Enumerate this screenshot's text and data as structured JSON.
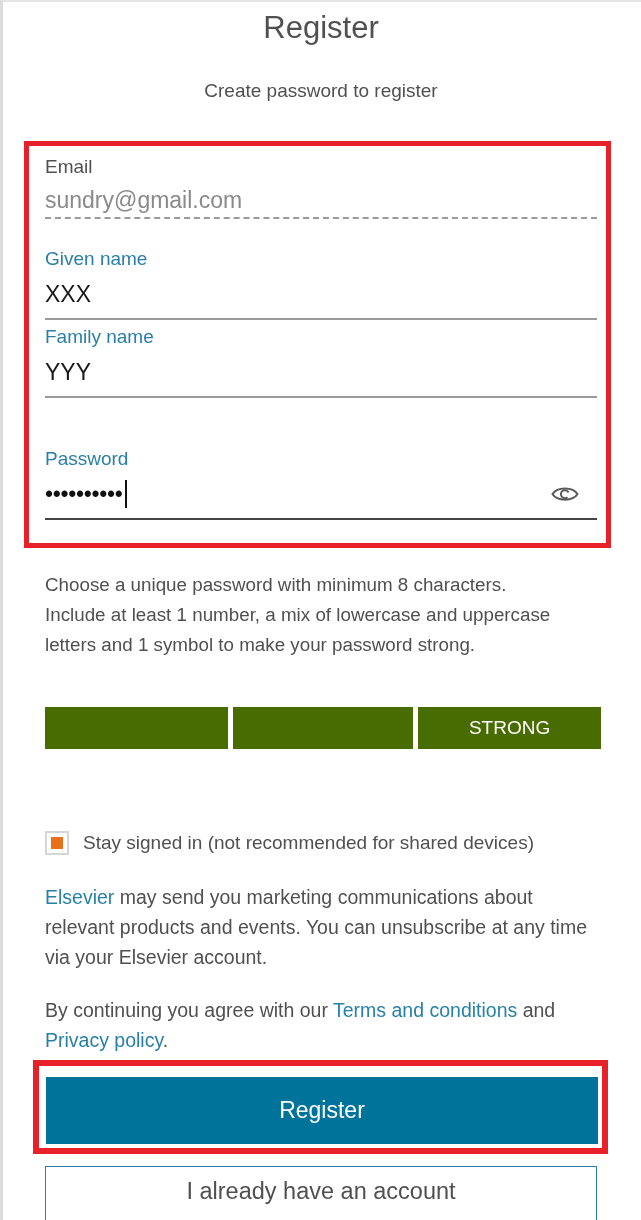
{
  "title": "Register",
  "subtitle": "Create password to register",
  "form": {
    "highlighted": true,
    "fields": [
      {
        "kind": "email",
        "label": "Email",
        "value": "sundry@gmail.com",
        "disabled": true,
        "focused": false
      },
      {
        "kind": "text",
        "label": "Given name",
        "value": "XXX",
        "disabled": false,
        "focused": false
      },
      {
        "kind": "text",
        "label": "Family name",
        "value": "YYY",
        "disabled": false,
        "focused": false
      },
      {
        "kind": "password",
        "label": "Password",
        "value": "••••••••••",
        "disabled": false,
        "focused": true
      }
    ]
  },
  "password_hint": [
    "Choose a unique password with minimum 8 characters.",
    "Include at least 1 number, a mix of lowercase and uppercase letters and 1 symbol to make your password strong."
  ],
  "strength_meter": {
    "level": 1,
    "label": "STRONG"
  },
  "stay_signed_in": {
    "label": "Stay signed in (not recommended for shared devices)",
    "checked": true
  },
  "marketing_notice": [
    {
      "kind": "link",
      "text": "Elsevier"
    },
    {
      "kind": "text",
      "text": " may send you marketing communications about relevant products and events. You can unsubscribe at any time via your Elsevier account."
    }
  ],
  "terms_notice": [
    {
      "kind": "text",
      "text": "By continuing you agree with our "
    },
    {
      "kind": "link",
      "text": "Terms and conditions"
    },
    {
      "kind": "text",
      "text": " and "
    },
    {
      "kind": "link",
      "text": "Privacy policy"
    },
    {
      "kind": "text",
      "text": "."
    }
  ],
  "register_button": {
    "label": "Register",
    "highlighted": true
  },
  "account_button": {
    "label": "I already have an account"
  }
}
